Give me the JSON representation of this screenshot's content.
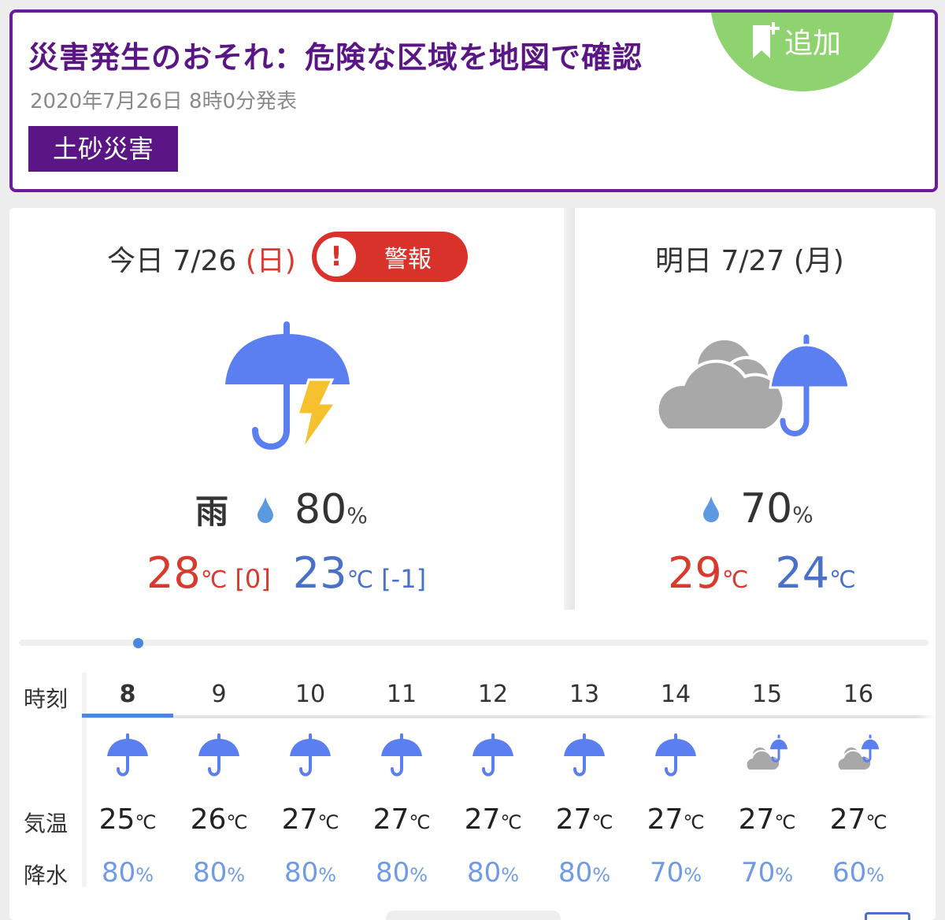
{
  "alert": {
    "title": "災害発生のおそれ：危険な区域を地図で確認",
    "date": "2020年7月26日 8時0分発表",
    "tag": "土砂災害",
    "add_label": "追加"
  },
  "today": {
    "label": "今日",
    "date": "7/26",
    "weekday": "(日)",
    "warning": "警報",
    "warning_mark": "!",
    "icon": "umbrella-thunder-icon",
    "condition": "雨",
    "pop": "80",
    "pop_unit": "%",
    "high": "28",
    "high_diff": "[0]",
    "low": "23",
    "low_diff": "[-1]",
    "temp_unit": "℃"
  },
  "tomorrow": {
    "label": "明日",
    "date": "7/27",
    "weekday": "(月)",
    "icon": "cloud-umbrella-icon",
    "pop": "70",
    "pop_unit": "%",
    "high": "29",
    "low": "24",
    "temp_unit": "℃"
  },
  "hourly": {
    "time_label": "時刻",
    "temp_label": "気温",
    "pop_label": "降水",
    "temp_unit": "℃",
    "pop_unit": "%",
    "hours": [
      {
        "hour": "8",
        "icon": "umbrella-icon",
        "temp": "25",
        "pop": "80"
      },
      {
        "hour": "9",
        "icon": "umbrella-icon",
        "temp": "26",
        "pop": "80"
      },
      {
        "hour": "10",
        "icon": "umbrella-icon",
        "temp": "27",
        "pop": "80"
      },
      {
        "hour": "11",
        "icon": "umbrella-icon",
        "temp": "27",
        "pop": "80"
      },
      {
        "hour": "12",
        "icon": "umbrella-icon",
        "temp": "27",
        "pop": "80"
      },
      {
        "hour": "13",
        "icon": "umbrella-icon",
        "temp": "27",
        "pop": "80"
      },
      {
        "hour": "14",
        "icon": "umbrella-icon",
        "temp": "27",
        "pop": "70"
      },
      {
        "hour": "15",
        "icon": "cloud-umbrella-icon",
        "temp": "27",
        "pop": "70"
      },
      {
        "hour": "16",
        "icon": "cloud-umbrella-icon",
        "temp": "27",
        "pop": "60"
      }
    ]
  },
  "colors": {
    "alert_purple": "#5a1684",
    "add_green": "#8fd270",
    "warning_red": "#d8322b",
    "high_red": "#d83a2e",
    "low_blue": "#4a71c9",
    "umbrella_blue": "#5b7ef0",
    "bolt_yellow": "#f5c12e",
    "cloud_gray": "#a8a8a8",
    "pop_blue": "#6f9be6"
  }
}
